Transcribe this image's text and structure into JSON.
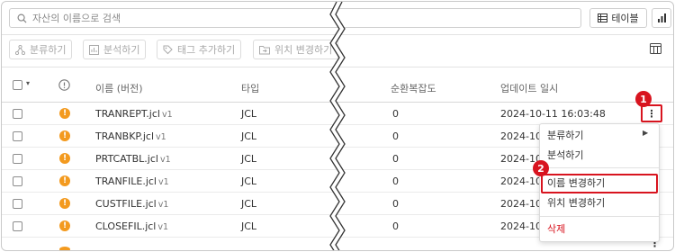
{
  "search": {
    "placeholder": "자산의 이름으로 검색"
  },
  "view_toggle": {
    "label": "테이블"
  },
  "toolbar": {
    "classify": "분류하기",
    "analyze": "분석하기",
    "add_tag": "태그 추가하기",
    "move": "위치 변경하기"
  },
  "table": {
    "headers": {
      "name": "이름 (버전)",
      "type": "타입",
      "complexity": "순환복잡도",
      "updated": "업데이트 일시"
    },
    "rows": [
      {
        "name": "TRANREPT.jcl",
        "version": "v1",
        "type": "JCL",
        "complexity": "0",
        "updated": "2024-10-11 16:03:48"
      },
      {
        "name": "TRANBKP.jcl",
        "version": "v1",
        "type": "JCL",
        "complexity": "0",
        "updated": "2024-10-"
      },
      {
        "name": "PRTCATBL.jcl",
        "version": "v1",
        "type": "JCL",
        "complexity": "0",
        "updated": "2024-10-"
      },
      {
        "name": "TRANFILE.jcl",
        "version": "v1",
        "type": "JCL",
        "complexity": "0",
        "updated": "2024-10-"
      },
      {
        "name": "CUSTFILE.jcl",
        "version": "v1",
        "type": "JCL",
        "complexity": "0",
        "updated": "2024-10-"
      },
      {
        "name": "CLOSEFIL.jcl",
        "version": "v1",
        "type": "JCL",
        "complexity": "0",
        "updated": "2024-10-"
      }
    ]
  },
  "context_menu": {
    "classify": "분류하기",
    "analyze": "분석하기",
    "rename": "이름 변경하기",
    "move": "위치 변경하기",
    "delete": "삭제"
  },
  "callouts": {
    "one": "1",
    "two": "2"
  },
  "colors": {
    "warning": "#f39a1f",
    "callout": "#d8141f",
    "delete_text": "#d8141f"
  }
}
